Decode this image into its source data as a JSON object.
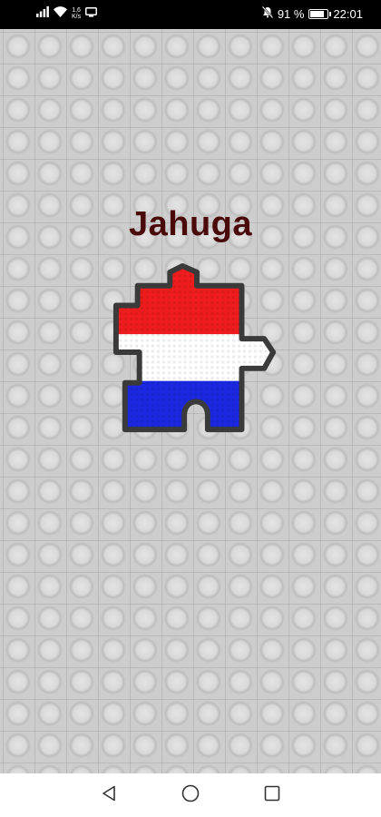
{
  "status_bar": {
    "net_speed_value": "1,6",
    "net_speed_unit": "K/s",
    "battery_percent": "91 %",
    "battery_level": 0.91,
    "time": "22:01"
  },
  "app": {
    "title": "Jahuga",
    "logo_colors": {
      "red": "#ee1c1c",
      "white": "#ffffff",
      "blue": "#1c28e0",
      "outline": "#3a3a3a"
    }
  },
  "nav_bar": {
    "back": "back-icon",
    "home": "home-icon",
    "recents": "recents-icon"
  }
}
